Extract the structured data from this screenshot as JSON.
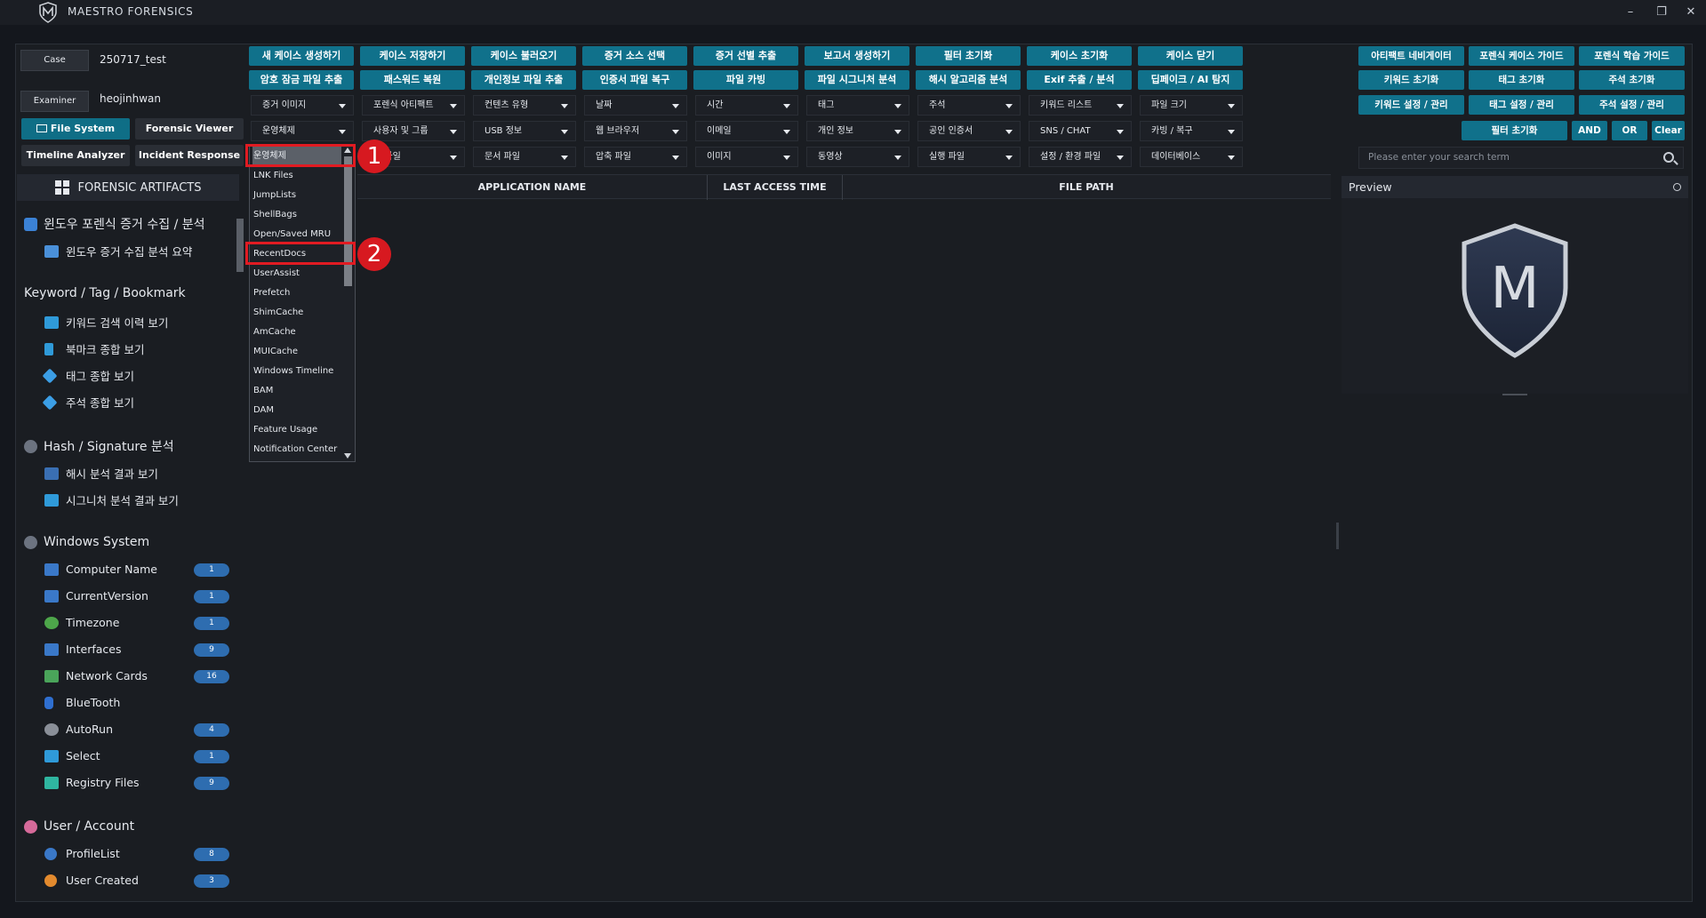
{
  "window": {
    "title": "MAESTRO FORENSICS",
    "controls": [
      "–",
      "❐",
      "✕"
    ]
  },
  "case": {
    "case_label": "Case",
    "case_value": "250717_test",
    "examiner_label": "Examiner",
    "examiner_value": "heojinhwan"
  },
  "nav_buttons": [
    "File System",
    "Forensic Viewer",
    "Timeline Analyzer",
    "Incident Response"
  ],
  "artifacts_title": "FORENSIC ARTIFACTS",
  "tree": {
    "sections": [
      {
        "label": "윈도우 포렌식 증거 수집 / 분석",
        "items": [
          {
            "label": "윈도우 증거 수집 분석 요약"
          }
        ]
      },
      {
        "label": "Keyword / Tag / Bookmark",
        "items": [
          {
            "label": "키워드 검색 이력 보기"
          },
          {
            "label": "북마크 종합 보기"
          },
          {
            "label": "태그 종합 보기"
          },
          {
            "label": "주석 종합 보기"
          }
        ]
      },
      {
        "label": "Hash / Signature 분석",
        "items": [
          {
            "label": "해시 분석 결과 보기"
          },
          {
            "label": "시그니처 분석 결과 보기"
          }
        ]
      },
      {
        "label": "Windows System",
        "items": [
          {
            "label": "Computer Name",
            "count": "1"
          },
          {
            "label": "CurrentVersion",
            "count": "1"
          },
          {
            "label": "Timezone",
            "count": "1"
          },
          {
            "label": "Interfaces",
            "count": "9"
          },
          {
            "label": "Network Cards",
            "count": "16"
          },
          {
            "label": "BlueTooth",
            "count": ""
          },
          {
            "label": "AutoRun",
            "count": "4"
          },
          {
            "label": "Select",
            "count": "1"
          },
          {
            "label": "Registry Files",
            "count": "9"
          }
        ]
      },
      {
        "label": "User / Account",
        "items": [
          {
            "label": "ProfileList",
            "count": "8"
          },
          {
            "label": "User Created",
            "count": "3"
          }
        ]
      }
    ]
  },
  "toolbar": {
    "row1": [
      "새 케이스 생성하기",
      "케이스 저장하기",
      "케이스 불러오기",
      "증거 소스 선택",
      "증거 선별 추출",
      "보고서 생성하기",
      "필터 초기화",
      "케이스 초기화",
      "케이스 닫기"
    ],
    "row2": [
      "암호 잠금 파일 추출",
      "패스워드 복원",
      "개인정보 파일 추출",
      "인증서 파일 복구",
      "파일 카빙",
      "파일 시그니처 분석",
      "해시 알고리즘 분석",
      "Exif 추출 / 분석",
      "딥페이크 / AI 탐지"
    ]
  },
  "filters": {
    "row1": [
      "증거 이미지",
      "포렌식 아티팩트",
      "컨텐츠 유형",
      "날짜",
      "시간",
      "태그",
      "주석",
      "키워드 리스트",
      "파일 크기"
    ],
    "row2": [
      "운영체제",
      "사용자 및 그룹",
      "USB 정보",
      "웹 브라우저",
      "이메일",
      "개인 정보",
      "공인 인증서",
      "SNS / CHAT",
      "카빙 / 복구"
    ],
    "row3": [
      "",
      "드 파일",
      "문서 파일",
      "압축 파일",
      "이미지",
      "동영상",
      "실행 파일",
      "설정 / 환경 파일",
      "데이터베이스"
    ]
  },
  "dropdown": {
    "options": [
      "운영체제",
      "LNK Files",
      "JumpLists",
      "ShellBags",
      "Open/Saved MRU",
      "RecentDocs",
      "UserAssist",
      "Prefetch",
      "ShimCache",
      "AmCache",
      "MUICache",
      "Windows Timeline",
      "BAM",
      "DAM",
      "Feature Usage",
      "Notification Center"
    ],
    "callouts": [
      "1",
      "2"
    ]
  },
  "table": {
    "columns": [
      "APPLICATION NAME",
      "LAST ACCESS TIME",
      "FILE PATH"
    ]
  },
  "right_panel": {
    "row1": [
      "아티팩트 네비게이터",
      "포렌식 케이스 가이드",
      "포렌식 학습 가이드"
    ],
    "row2": [
      "키워드 초기화",
      "태그 초기화",
      "주석 초기화"
    ],
    "row3": [
      "키워드 설정 / 관리",
      "태그 설정 / 관리",
      "주석 설정 / 관리"
    ],
    "row4": [
      "필터 초기화",
      "AND",
      "OR",
      "Clear"
    ],
    "search_placeholder": "Please enter your search term",
    "preview_title": "Preview",
    "preview_logo_letter": "M"
  },
  "colors": {
    "accent": "#10718b",
    "highlight": "#e11b22",
    "badge": "#2e6db0"
  }
}
